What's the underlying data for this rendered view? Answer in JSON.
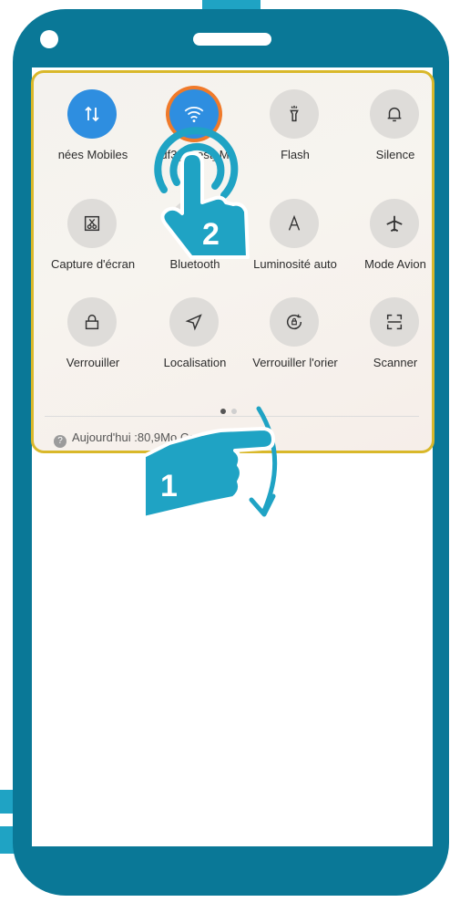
{
  "tiles": [
    {
      "label": "nées Mobiles",
      "icon": "data-arrows-icon",
      "active": true
    },
    {
      "label": "df3_guest_M",
      "icon": "wifi-icon",
      "active": true
    },
    {
      "label": "Flash",
      "icon": "flashlight-icon",
      "active": false
    },
    {
      "label": "Silence",
      "icon": "bell-icon",
      "active": false
    },
    {
      "label": "Capture d'écran",
      "icon": "screenshot-icon",
      "active": false
    },
    {
      "label": "Bluetooth",
      "icon": "bluetooth-icon",
      "active": false
    },
    {
      "label": "Luminosité auto",
      "icon": "brightness-auto-icon",
      "active": false
    },
    {
      "label": "Mode Avion",
      "icon": "airplane-icon",
      "active": false
    },
    {
      "label": "Verrouiller",
      "icon": "lock-icon",
      "active": false
    },
    {
      "label": "Localisation",
      "icon": "location-icon",
      "active": false
    },
    {
      "label": "Verrouiller l'orier",
      "icon": "rotation-lock-icon",
      "active": false
    },
    {
      "label": "Scanner",
      "icon": "scanner-icon",
      "active": false
    }
  ],
  "usage": {
    "text": "Aujourd'hui :80,9Mo  Ce mois : 7,41Go"
  },
  "steps": {
    "one": "1",
    "two": "2"
  },
  "colors": {
    "frame": "#0a7897",
    "accent": "#1fa3c4",
    "active_tile": "#2e8ee0",
    "panel_border": "#d9b82a",
    "wifi_ring": "#f07a2a"
  }
}
